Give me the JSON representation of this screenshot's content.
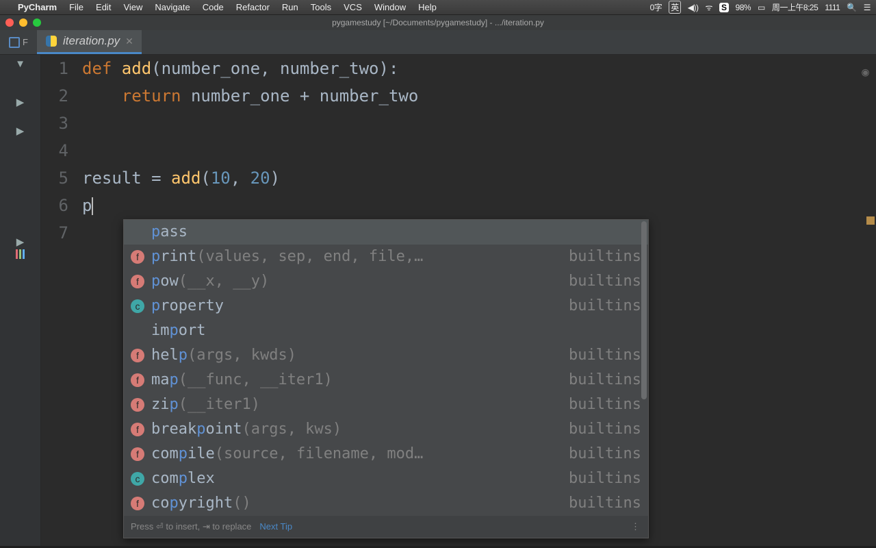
{
  "colors": {
    "keyword": "#cc7832",
    "function": "#ffc66d",
    "number": "#6897bb",
    "text": "#a9b7c6",
    "highlight_match": "#6092d6",
    "popup_bg": "#46484a",
    "editor_bg": "#2b2b2b"
  },
  "menubar": {
    "app": "PyCharm",
    "items": [
      "File",
      "Edit",
      "View",
      "Navigate",
      "Code",
      "Refactor",
      "Run",
      "Tools",
      "VCS",
      "Window",
      "Help"
    ],
    "status": {
      "ime1": "0字",
      "ime2": "●",
      "ime3": "⌘",
      "ime4": "英",
      "brightness": "☼",
      "volume": "◀))",
      "wifi": "⌇",
      "app_icon": "S",
      "battery_pct": "98%",
      "battery_icon": "⚡",
      "datetime": "周一上午8:25",
      "extra": "1111",
      "search": "🔍",
      "menu": "☰"
    }
  },
  "window": {
    "title": "pygamestudy [~/Documents/pygamestudy] - .../iteration.py"
  },
  "tabs": {
    "hidden_label": "F",
    "active": {
      "filename": "iteration.py",
      "italic": true
    }
  },
  "editor": {
    "lines": [
      {
        "n": 1,
        "tokens": [
          {
            "t": "def ",
            "c": "kw"
          },
          {
            "t": "add",
            "c": "fn"
          },
          {
            "t": "(number_one, number_two):",
            "c": ""
          }
        ]
      },
      {
        "n": 2,
        "tokens": [
          {
            "t": "    ",
            "c": ""
          },
          {
            "t": "return ",
            "c": "kw"
          },
          {
            "t": "number_one + number_two",
            "c": ""
          }
        ]
      },
      {
        "n": 3,
        "tokens": []
      },
      {
        "n": 4,
        "tokens": []
      },
      {
        "n": 5,
        "tokens": [
          {
            "t": "result = ",
            "c": ""
          },
          {
            "t": "add",
            "c": "fn"
          },
          {
            "t": "(",
            "c": ""
          },
          {
            "t": "10",
            "c": "num"
          },
          {
            "t": ", ",
            "c": ""
          },
          {
            "t": "20",
            "c": "num"
          },
          {
            "t": ")",
            "c": ""
          }
        ]
      },
      {
        "n": 6,
        "tokens": [
          {
            "t": "p",
            "c": ""
          }
        ],
        "caret": true
      },
      {
        "n": 7,
        "tokens": []
      }
    ]
  },
  "autocomplete": {
    "visible": true,
    "selected_index": 0,
    "items": [
      {
        "badge": "",
        "pre": "p",
        "mid": "ass",
        "post": "",
        "origin": ""
      },
      {
        "badge": "f",
        "pre": "p",
        "mid": "rint",
        "post": "(values, sep, end, file,…",
        "origin": "builtins"
      },
      {
        "badge": "f",
        "pre": "p",
        "mid": "ow",
        "post": "(__x, __y)",
        "origin": "builtins"
      },
      {
        "badge": "c",
        "pre": "p",
        "mid": "roperty",
        "post": "",
        "origin": "builtins"
      },
      {
        "badge": "",
        "pre_plain": "im",
        "pre": "p",
        "mid": "ort",
        "post": "",
        "origin": ""
      },
      {
        "badge": "f",
        "pre_plain": "hel",
        "pre": "p",
        "mid": "",
        "post": "(args, kwds)",
        "origin": "builtins"
      },
      {
        "badge": "f",
        "pre_plain": "ma",
        "pre": "p",
        "mid": "",
        "post": "(__func, __iter1)",
        "origin": "builtins"
      },
      {
        "badge": "f",
        "pre_plain": "zi",
        "pre": "p",
        "mid": "",
        "post": "(__iter1)",
        "origin": "builtins"
      },
      {
        "badge": "f",
        "pre_plain": "break",
        "pre": "p",
        "mid": "oint",
        "post": "(args, kws)",
        "origin": "builtins"
      },
      {
        "badge": "f",
        "pre_plain": "com",
        "pre": "p",
        "mid": "ile",
        "post": "(source, filename, mod…",
        "origin": "builtins"
      },
      {
        "badge": "c",
        "pre_plain": "com",
        "pre": "p",
        "mid": "lex",
        "post": "",
        "origin": "builtins"
      },
      {
        "badge": "f",
        "pre_plain": "co",
        "pre": "p",
        "mid": "yright",
        "post": "()",
        "origin": "builtins"
      }
    ],
    "footer": {
      "hint1": "Press ⏎ to insert, ⇥ to replace",
      "link": "Next Tip",
      "more": "⋮"
    }
  }
}
